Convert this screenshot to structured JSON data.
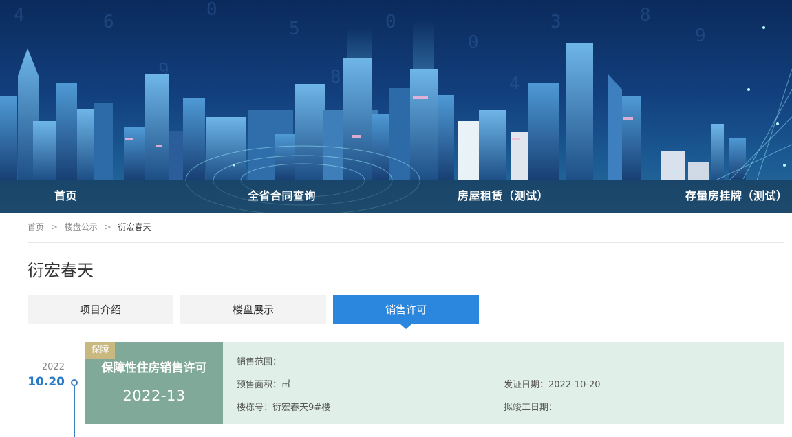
{
  "nav": {
    "items": [
      {
        "label": "首页"
      },
      {
        "label": "全省合同查询"
      },
      {
        "label": "房屋租赁（测试）"
      },
      {
        "label": "存量房挂牌（测试）"
      }
    ]
  },
  "breadcrumb": {
    "home": "首页",
    "sep": ">",
    "section": "楼盘公示",
    "current": "衍宏春天"
  },
  "page": {
    "title": "衍宏春天"
  },
  "tabs": [
    {
      "label": "项目介绍",
      "active": false
    },
    {
      "label": "楼盘展示",
      "active": false
    },
    {
      "label": "销售许可",
      "active": true
    }
  ],
  "timeline": {
    "year": "2022",
    "date": "10.20"
  },
  "permit": {
    "tag": "保障",
    "name": "保障性住房销售许可",
    "number": "2022-13",
    "sales_scope_label": "销售范围：",
    "sales_scope_value": "",
    "presale_area_label": "预售面积：",
    "presale_area_value": "㎡",
    "building_label": "楼栋号：",
    "building_value": "衍宏春天9#楼",
    "issue_date_label": "发证日期：",
    "issue_date_value": "2022-10-20",
    "completion_label": "拟竣工日期：",
    "completion_value": ""
  },
  "colors": {
    "accent": "#2b87dd",
    "permit_green": "#80a999",
    "permit_bg": "#e1efe9",
    "tag_gold": "#c9b87f",
    "banner_dark": "#0b2a5c"
  }
}
